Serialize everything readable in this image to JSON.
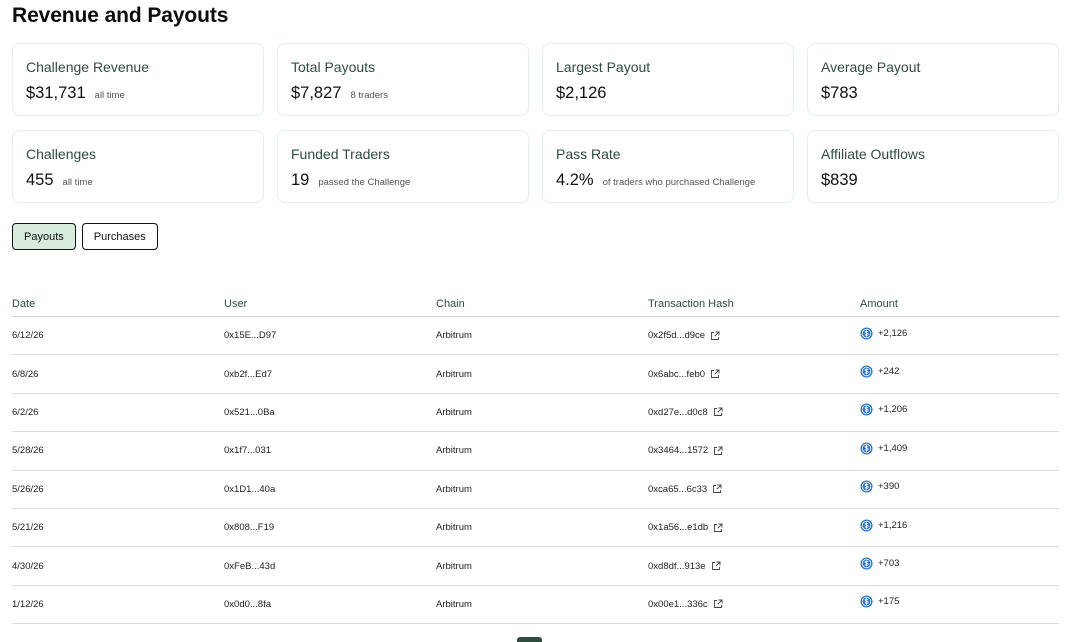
{
  "title": "Revenue and Payouts",
  "cards": [
    {
      "label": "Challenge Revenue",
      "value": "$31,731",
      "note": "all time"
    },
    {
      "label": "Total Payouts",
      "value": "$7,827",
      "note": "8 traders"
    },
    {
      "label": "Largest Payout",
      "value": "$2,126",
      "note": ""
    },
    {
      "label": "Average Payout",
      "value": "$783",
      "note": ""
    },
    {
      "label": "Challenges",
      "value": "455",
      "note": "all time"
    },
    {
      "label": "Funded Traders",
      "value": "19",
      "note": "passed the Challenge"
    },
    {
      "label": "Pass Rate",
      "value": "4.2%",
      "note": "of traders who purchased Challenge"
    },
    {
      "label": "Affiliate Outflows",
      "value": "$839",
      "note": ""
    }
  ],
  "tabs": {
    "payouts": "Payouts",
    "purchases": "Purchases"
  },
  "table": {
    "headers": {
      "date": "Date",
      "user": "User",
      "chain": "Chain",
      "hash": "Transaction Hash",
      "amount": "Amount"
    },
    "rows": [
      {
        "date": "6/12/26",
        "user": "0x15E...D97",
        "chain": "Arbitrum",
        "hash": "0x2f5d...d9ce",
        "amount": "+2,126"
      },
      {
        "date": "6/8/26",
        "user": "0xb2f...Ed7",
        "chain": "Arbitrum",
        "hash": "0x6abc...feb0",
        "amount": "+242"
      },
      {
        "date": "6/2/26",
        "user": "0x521...0Ba",
        "chain": "Arbitrum",
        "hash": "0xd27e...d0c8",
        "amount": "+1,206"
      },
      {
        "date": "5/28/26",
        "user": "0x1f7...031",
        "chain": "Arbitrum",
        "hash": "0x3464...1572",
        "amount": "+1,409"
      },
      {
        "date": "5/26/26",
        "user": "0x1D1...40a",
        "chain": "Arbitrum",
        "hash": "0xca65...6c33",
        "amount": "+390"
      },
      {
        "date": "5/21/26",
        "user": "0x808...F19",
        "chain": "Arbitrum",
        "hash": "0x1a56...e1db",
        "amount": "+1,216"
      },
      {
        "date": "4/30/26",
        "user": "0xFeB...43d",
        "chain": "Arbitrum",
        "hash": "0xd8df...913e",
        "amount": "+703"
      },
      {
        "date": "1/12/26",
        "user": "0x0d0...8fa",
        "chain": "Arbitrum",
        "hash": "0x00e1...336c",
        "amount": "+175"
      }
    ]
  },
  "icons": {
    "hash_link": "external-link-icon",
    "amount_coin": "usdc-coin-icon"
  },
  "colors": {
    "accent": "#2f4d3e",
    "active_tab": "#d8ecdd",
    "coin": "#2775ca"
  }
}
